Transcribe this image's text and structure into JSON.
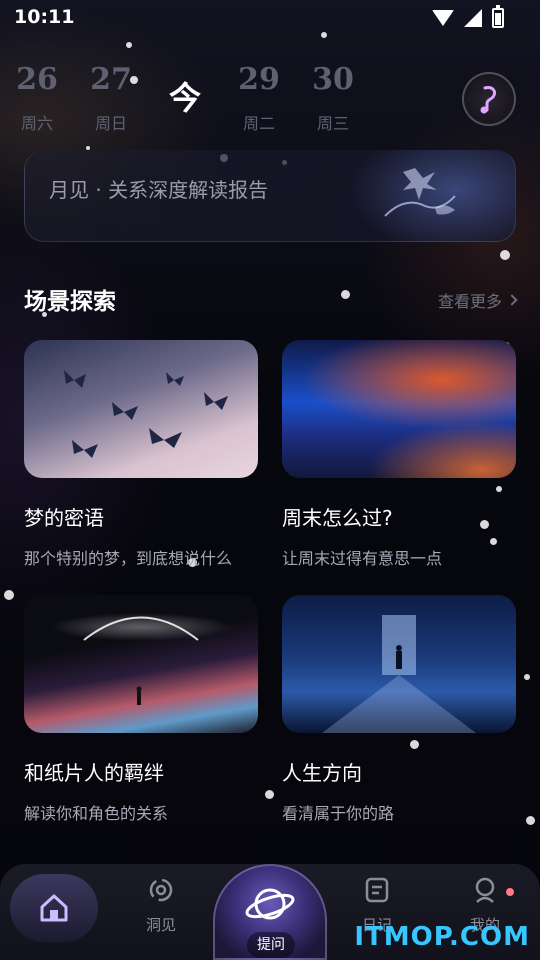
{
  "status_bar": {
    "time": "10:11",
    "icons": [
      "wifi-icon",
      "signal-icon",
      "battery-charging-icon"
    ]
  },
  "date_strip": {
    "days": [
      {
        "num": "26",
        "weekday": "周六"
      },
      {
        "num": "27",
        "weekday": "周日"
      },
      {
        "num": "今",
        "weekday": ""
      },
      {
        "num": "29",
        "weekday": "周二"
      },
      {
        "num": "30",
        "weekday": "周三"
      }
    ]
  },
  "report_card": {
    "title": "月见 · 关系深度解读报告"
  },
  "scene_section": {
    "title": "场景探索",
    "more_label": "查看更多",
    "cards": [
      {
        "title": "梦的密语",
        "subtitle": "那个特别的梦，到底想说什么"
      },
      {
        "title": "周末怎么过?",
        "subtitle": "让周末过得有意思一点"
      },
      {
        "title": "和纸片人的羁绊",
        "subtitle": "解读你和角色的关系"
      },
      {
        "title": "人生方向",
        "subtitle": "看清属于你的路"
      }
    ]
  },
  "bottom_nav": {
    "items": [
      {
        "label": "",
        "icon": "home-icon"
      },
      {
        "label": "洞见",
        "icon": "swirl-icon"
      },
      {
        "label": "提问",
        "icon": "planet-chat-icon"
      },
      {
        "label": "日记",
        "icon": "diary-icon"
      },
      {
        "label": "我的",
        "icon": "profile-icon"
      }
    ]
  },
  "watermark": "ITMOP.COM",
  "colors": {
    "accent": "#b9a8ff",
    "muted": "#5d6171",
    "badge": "#ff7a8a",
    "watermark": "#37c6ff"
  }
}
